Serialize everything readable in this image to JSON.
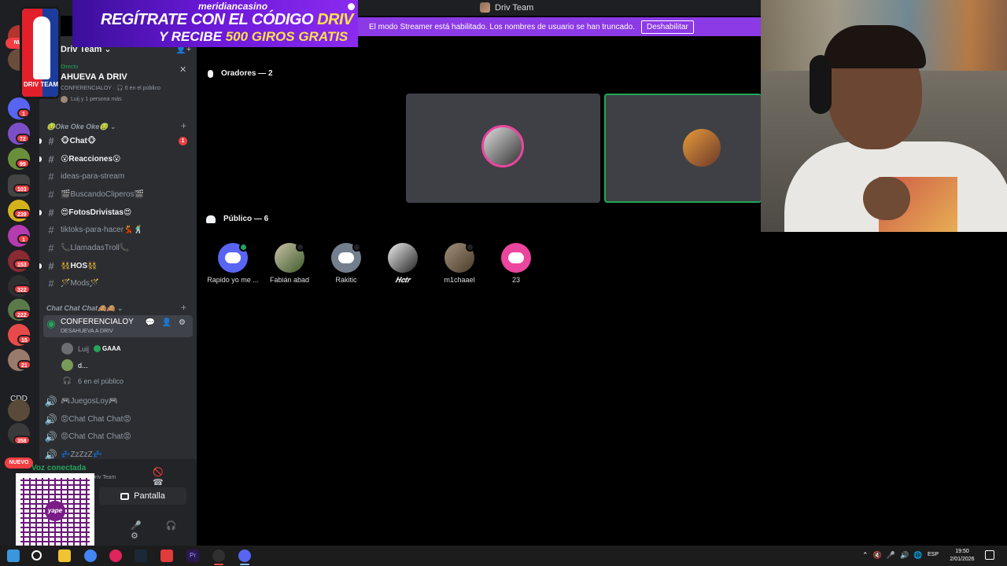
{
  "window": {
    "title": "Driv Team"
  },
  "ad": {
    "brand": "meridiancasino",
    "line1_a": "REGÍTRATE CON EL CÓDIGO ",
    "line1_b": "DRIV",
    "line2_a": "Y RECIBE ",
    "line2_b": "500 GIROS GRATIS"
  },
  "logo_text": "DRIV TEAM",
  "streamer": {
    "message": "El modo Streamer está habilitado. Los nombres de usuario se han truncado.",
    "button": "Deshabilitar"
  },
  "server": {
    "name": "Driv Team"
  },
  "stage": {
    "live_label": "Directo",
    "title": "AHUEVA A DRIV",
    "info": "CONFERENCIALOY · 🎧 6 en el público",
    "listeners": "Luij y 1 persona más"
  },
  "categories": [
    {
      "name": "🤢Oke Oke Oke🤢 ⌄"
    },
    {
      "name": "Chat Chat Chat🙈🙈 ⌄"
    }
  ],
  "channels": [
    {
      "icon": "#",
      "label": "🐵Chat🐵",
      "count": "1"
    },
    {
      "icon": "#",
      "label": "😮Reacciones😮"
    },
    {
      "icon": "#",
      "label": "ideas-para-stream"
    },
    {
      "icon": "#",
      "label": "🎬BuscandoCliperos🎬"
    },
    {
      "icon": "#",
      "label": "😍FotosDrivistas😍"
    },
    {
      "icon": "#",
      "label": "tiktoks-para-hacer💃🕺"
    },
    {
      "icon": "#",
      "label": "📞LlamadasTroll📞"
    },
    {
      "icon": "#",
      "label": "👯HOS👯"
    },
    {
      "icon": "#",
      "label": "🪄Mods🪄"
    }
  ],
  "active_channel": {
    "name": "CONFERENCIALOY",
    "sub": "DESAHUEVA A DRIV",
    "tools": "💬 👤 ⚙"
  },
  "stage_members": [
    {
      "name": "Luij",
      "tag": "GAAA"
    },
    {
      "name": "d..."
    },
    {
      "name": "6 en el público"
    }
  ],
  "voice_channels": [
    {
      "label": "🎮JuegosLoy🎮"
    },
    {
      "label": "😡Chat Chat Chat😡"
    },
    {
      "label": "😡Chat Chat Chat😡"
    },
    {
      "label": "💤ZzZzZ💤"
    }
  ],
  "voice_panel": {
    "status": "Voz conectada",
    "sub": "Driv Team",
    "screen": "Pantalla",
    "controls": "🚫 ☎",
    "user_tools": "🎤 🎧 ⚙"
  },
  "qr_text": "yape",
  "rail": {
    "cdd": "CDD",
    "new_label": "NUEVO",
    "new_top": "NUE",
    "badges": [
      "1",
      "72",
      "99",
      "103",
      "239",
      "1",
      "153",
      "322",
      "222",
      "15",
      "21",
      "358"
    ]
  },
  "speakers": {
    "header": "Oradores — 2"
  },
  "public": {
    "header": "Público — 6",
    "members": [
      {
        "name": "Rapido yo me ..."
      },
      {
        "name": "Fabián abad"
      },
      {
        "name": "Rakitic"
      },
      {
        "name": "𝑯𝒄𝒕𝒓"
      },
      {
        "name": "m1chaael"
      },
      {
        "name": "23"
      }
    ]
  },
  "taskbar": {
    "lang": "ESP",
    "time": "19:50",
    "date": "2/01/2026"
  },
  "colors": {
    "blurple": "#5865f2",
    "green": "#23a55a",
    "red": "#f23f43",
    "pink": "#eb459e",
    "streamer": "#8c3ae6"
  }
}
